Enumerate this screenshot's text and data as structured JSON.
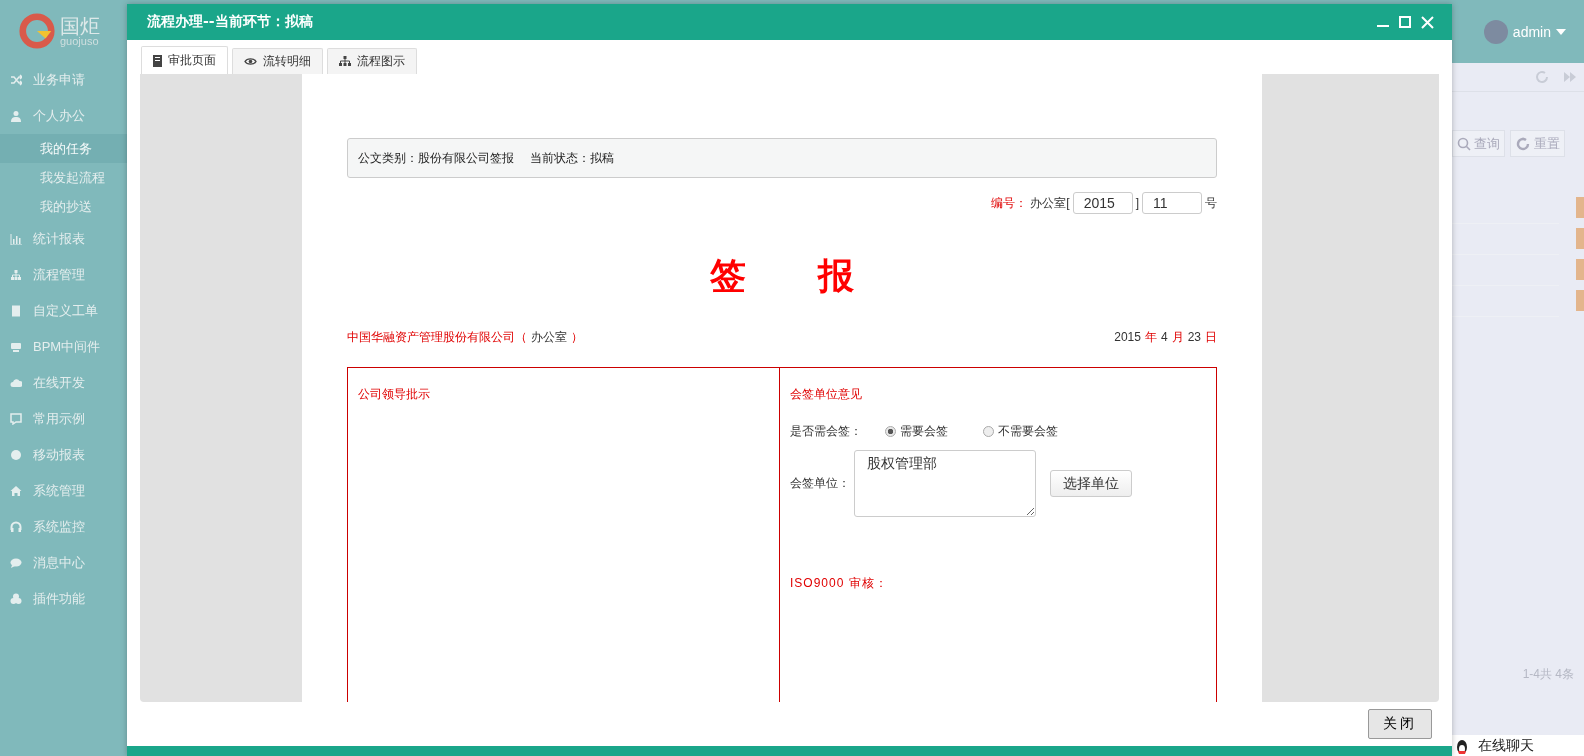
{
  "sidebar": {
    "logo_text": "国炬",
    "logo_subtext": "guojuso",
    "items": [
      {
        "label": "业务申请",
        "selected": false
      },
      {
        "label": "个人办公",
        "selected": false,
        "children": [
          {
            "label": "我的任务",
            "selected": true
          },
          {
            "label": "我发起流程",
            "selected": false
          },
          {
            "label": "我的抄送",
            "selected": false
          }
        ]
      },
      {
        "label": "统计报表",
        "selected": false
      },
      {
        "label": "流程管理",
        "selected": false
      },
      {
        "label": "自定义工单",
        "selected": false
      },
      {
        "label": "BPM中间件",
        "selected": false
      },
      {
        "label": "在线开发",
        "selected": false
      },
      {
        "label": "常用示例",
        "selected": false
      },
      {
        "label": "移动报表",
        "selected": false
      },
      {
        "label": "系统管理",
        "selected": false
      },
      {
        "label": "系统监控",
        "selected": false
      },
      {
        "label": "消息中心",
        "selected": false
      },
      {
        "label": "插件功能",
        "selected": false
      }
    ]
  },
  "header": {
    "user": "admin"
  },
  "toolbar": {
    "buttons": [
      "查询",
      "重置"
    ]
  },
  "pager": "1-4共 4条",
  "chat": "在线聊天",
  "modal": {
    "title": "流程办理--当前环节：拟稿",
    "tabs": [
      {
        "label": "审批页面",
        "selected": true
      },
      {
        "label": "流转明细",
        "selected": false
      },
      {
        "label": "流程图示",
        "selected": false
      }
    ],
    "document": {
      "info": [
        "公文类别：股份有限公司签报",
        "当前状态：拟稿"
      ],
      "number": {
        "label": "编号：",
        "prefix": "办公室[",
        "year": "2015",
        "separator": "]",
        "value": "11",
        "suffix": "号"
      },
      "heading": "签　　报",
      "company": {
        "name": "中国华融资产管理股份有限公司（",
        "department": "办公室",
        "close": "）"
      },
      "date": [
        {
          "text": "2015",
          "kind": "value"
        },
        {
          "text": "年",
          "kind": "unit"
        },
        {
          "text": "4",
          "kind": "value"
        },
        {
          "text": "月",
          "kind": "unit"
        },
        {
          "text": "23",
          "kind": "value"
        },
        {
          "text": "日",
          "kind": "unit"
        }
      ],
      "left_title": "公司领导批示",
      "right_title": "会签单位意见",
      "need_label": "是否需会签：",
      "options": [
        {
          "label": "需要会签",
          "selected": true
        },
        {
          "label": "不需要会签",
          "selected": false
        }
      ],
      "unit_label": "会签单位：",
      "unit_value": "股权管理部",
      "unit_button": "选择单位",
      "iso_label": "ISO9000 审核："
    },
    "close_button": "关闭"
  }
}
